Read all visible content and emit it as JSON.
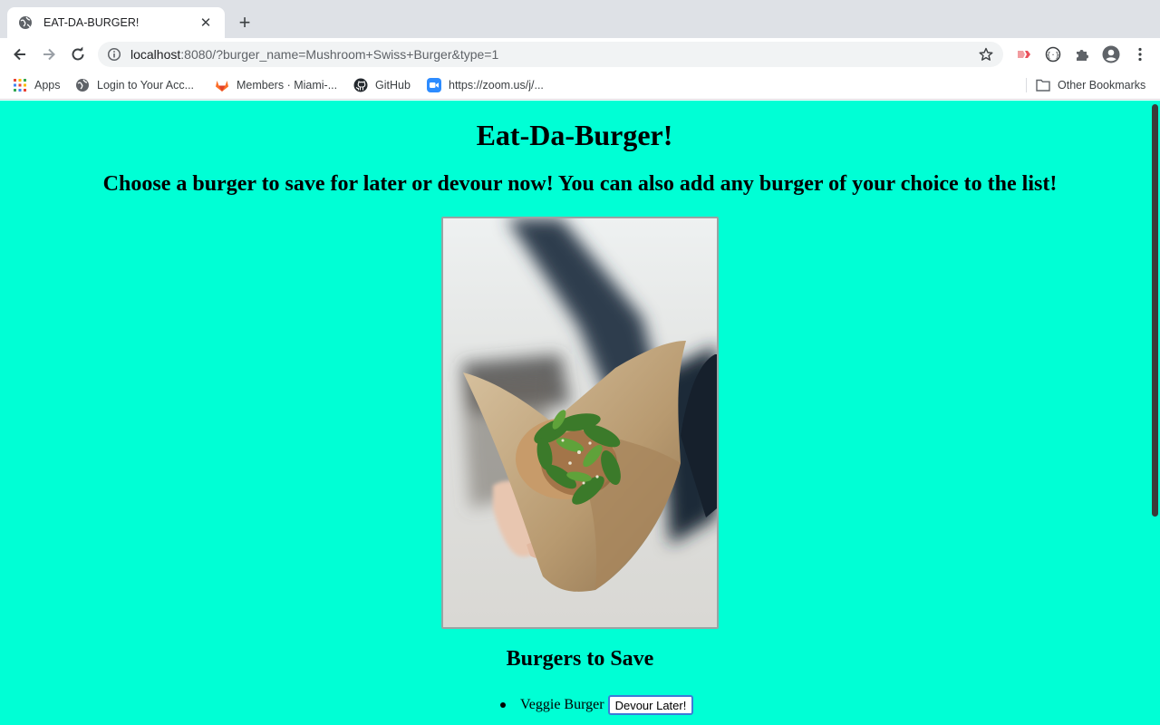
{
  "browser": {
    "tab": {
      "title": "EAT-DA-BURGER!",
      "favicon": "globe-icon",
      "close": "✕"
    },
    "new_tab": "+",
    "url": {
      "host": "localhost",
      "rest": ":8080/?burger_name=Mushroom+Swiss+Burger&type=1"
    },
    "bookmarks": [
      {
        "label": "Apps",
        "icon": "apps-grid-icon"
      },
      {
        "label": "Login to Your Acc...",
        "icon": "globe-icon"
      },
      {
        "label": "Members · Miami-...",
        "icon": "gitlab-icon"
      },
      {
        "label": "GitHub",
        "icon": "github-icon"
      },
      {
        "label": "https://zoom.us/j/...",
        "icon": "zoom-icon"
      }
    ],
    "other_bookmarks": {
      "label": "Other Bookmarks",
      "icon": "folder-icon"
    }
  },
  "page": {
    "title": "Eat-Da-Burger!",
    "subtitle": "Choose a burger to save for later or devour now! You can also add any burger of your choice to the list!",
    "section_title": "Burgers to Save",
    "burgers": [
      {
        "name": "Veggie Burger",
        "button": "Devour Later!"
      }
    ]
  },
  "colors": {
    "page_background": "#00ffd5",
    "tab_strip": "#dee1e6",
    "button_focus": "#3d7bd9"
  }
}
